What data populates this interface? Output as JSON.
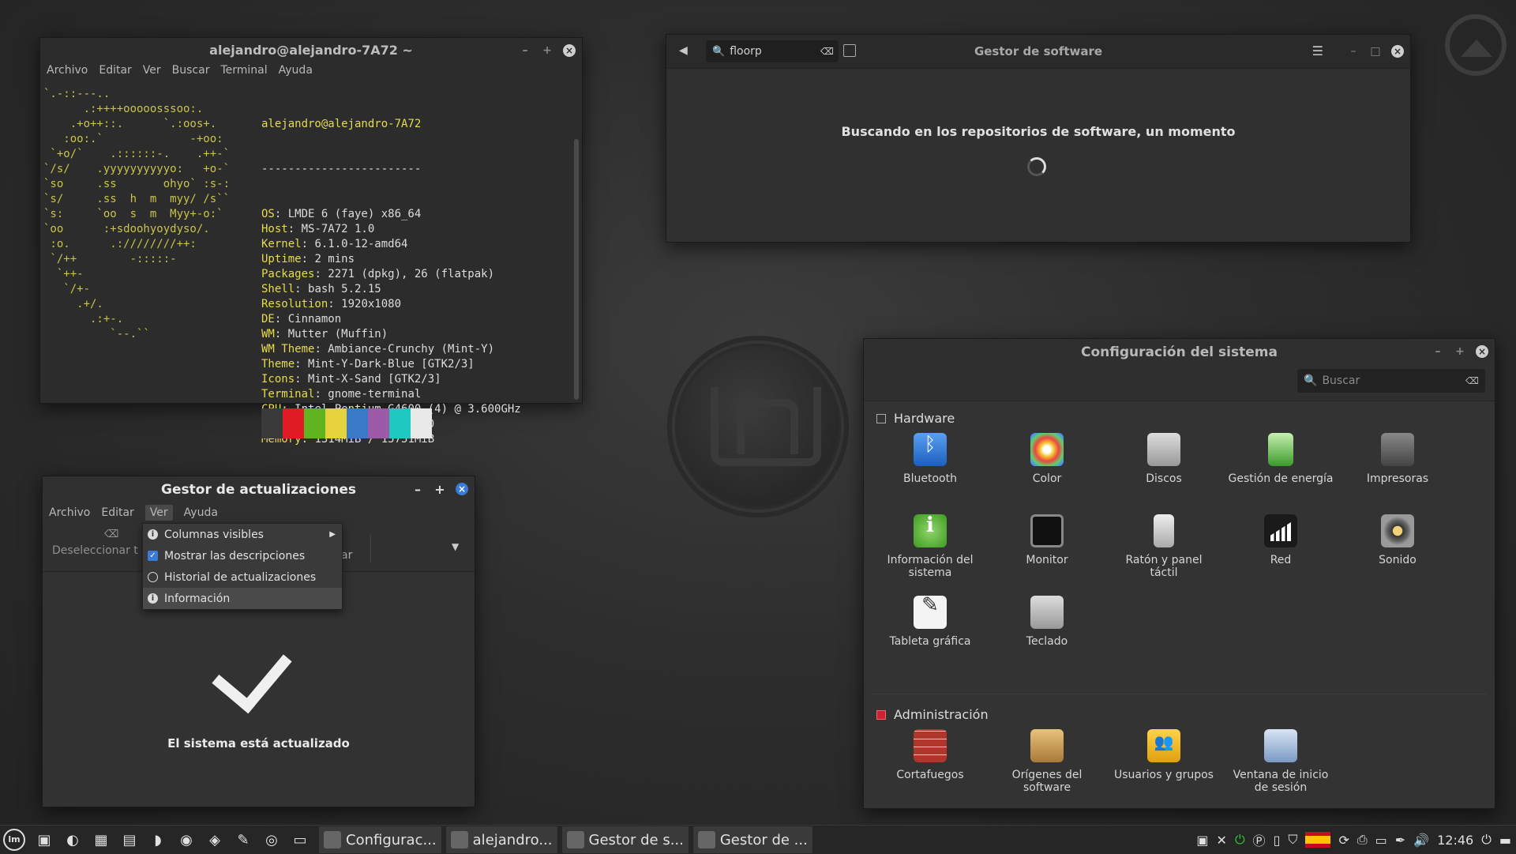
{
  "terminal": {
    "title": "alejandro@alejandro-7A72 ~",
    "menu": [
      "Archivo",
      "Editar",
      "Ver",
      "Buscar",
      "Terminal",
      "Ayuda"
    ],
    "ascii": "`.-::---..\n      .:++++ooooosssoo:.\n    .+o++::.      `.:oos+.\n   :oo:.`             -+oo:\n `+o/`    .::::::-.    .++-`\n`/s/    .yyyyyyyyyyo:   +o-`\n`so     .ss       ohyo` :s-:\n`s/     .ss  h  m  myy/ /s``\n`s:     `oo  s  m  Myy+-o:`\n`oo      :+sdoohyoydyso/.\n :o.      .:////////++:\n `/++        -:::::-\n  `++-\n   `/+-\n     .+/.\n       .:+-.\n          `--.``",
    "user_host": "alejandro@alejandro-7A72",
    "separator": "------------------------",
    "info": [
      {
        "k": "OS",
        "v": "LMDE 6 (faye) x86_64"
      },
      {
        "k": "Host",
        "v": "MS-7A72 1.0"
      },
      {
        "k": "Kernel",
        "v": "6.1.0-12-amd64"
      },
      {
        "k": "Uptime",
        "v": "2 mins"
      },
      {
        "k": "Packages",
        "v": "2271 (dpkg), 26 (flatpak)"
      },
      {
        "k": "Shell",
        "v": "bash 5.2.15"
      },
      {
        "k": "Resolution",
        "v": "1920x1080"
      },
      {
        "k": "DE",
        "v": "Cinnamon"
      },
      {
        "k": "WM",
        "v": "Mutter (Muffin)"
      },
      {
        "k": "WM Theme",
        "v": "Ambiance-Crunchy (Mint-Y)"
      },
      {
        "k": "Theme",
        "v": "Mint-Y-Dark-Blue [GTK2/3]"
      },
      {
        "k": "Icons",
        "v": "Mint-X-Sand [GTK2/3]"
      },
      {
        "k": "Terminal",
        "v": "gnome-terminal"
      },
      {
        "k": "CPU",
        "v": "Intel Pentium G4600 (4) @ 3.600GHz"
      },
      {
        "k": "GPU",
        "v": "Intel HD Graphics 630"
      },
      {
        "k": "Memory",
        "v": "1314MiB / 15751MiB"
      }
    ],
    "palette": [
      "#3a3a3a",
      "#e01b24",
      "#5fb41f",
      "#e6d23a",
      "#3a78c8",
      "#9c5aa8",
      "#1fc8c0",
      "#e8e8e8"
    ]
  },
  "software": {
    "title": "Gestor de software",
    "search_value": "floorp",
    "message": "Buscando en los repositorios de software, un momento"
  },
  "updates": {
    "title": "Gestor de actualizaciones",
    "menu": [
      "Archivo",
      "Editar",
      "Ver",
      "Ayuda"
    ],
    "toolbar_deselect": "Deseleccionar t",
    "toolbar_partial": "ar",
    "dropdown": [
      "Columnas visibles",
      "Mostrar las descripciones",
      "Historial de actualizaciones",
      "Información"
    ],
    "status": "El sistema está actualizado"
  },
  "settings": {
    "title": "Configuración del sistema",
    "search_placeholder": "Buscar",
    "hardware_label": "Hardware",
    "hardware": [
      {
        "label": "Bluetooth",
        "icon": "bluetooth-icon"
      },
      {
        "label": "Color",
        "icon": "color-icon"
      },
      {
        "label": "Discos",
        "icon": "disks-icon"
      },
      {
        "label": "Gestión de energía",
        "icon": "power-icon"
      },
      {
        "label": "Impresoras",
        "icon": "printer-icon"
      },
      {
        "label": "Información del sistema",
        "icon": "info-icon"
      },
      {
        "label": "Monitor",
        "icon": "monitor-icon"
      },
      {
        "label": "Ratón y panel táctil",
        "icon": "mouse-icon"
      },
      {
        "label": "Red",
        "icon": "network-icon"
      },
      {
        "label": "Sonido",
        "icon": "sound-icon"
      },
      {
        "label": "Tableta gráfica",
        "icon": "tablet-icon"
      },
      {
        "label": "Teclado",
        "icon": "keyboard-icon"
      }
    ],
    "admin_label": "Administración",
    "admin": [
      {
        "label": "Cortafuegos",
        "icon": "firewall-icon"
      },
      {
        "label": "Orígenes del software",
        "icon": "software-sources-icon"
      },
      {
        "label": "Usuarios y grupos",
        "icon": "users-icon"
      },
      {
        "label": "Ventana de inicio de sesión",
        "icon": "login-window-icon"
      }
    ]
  },
  "taskbar": {
    "tasks": [
      "Configurac...",
      "alejandro...",
      "Gestor de s...",
      "Gestor de ..."
    ],
    "clock": "12:46"
  }
}
